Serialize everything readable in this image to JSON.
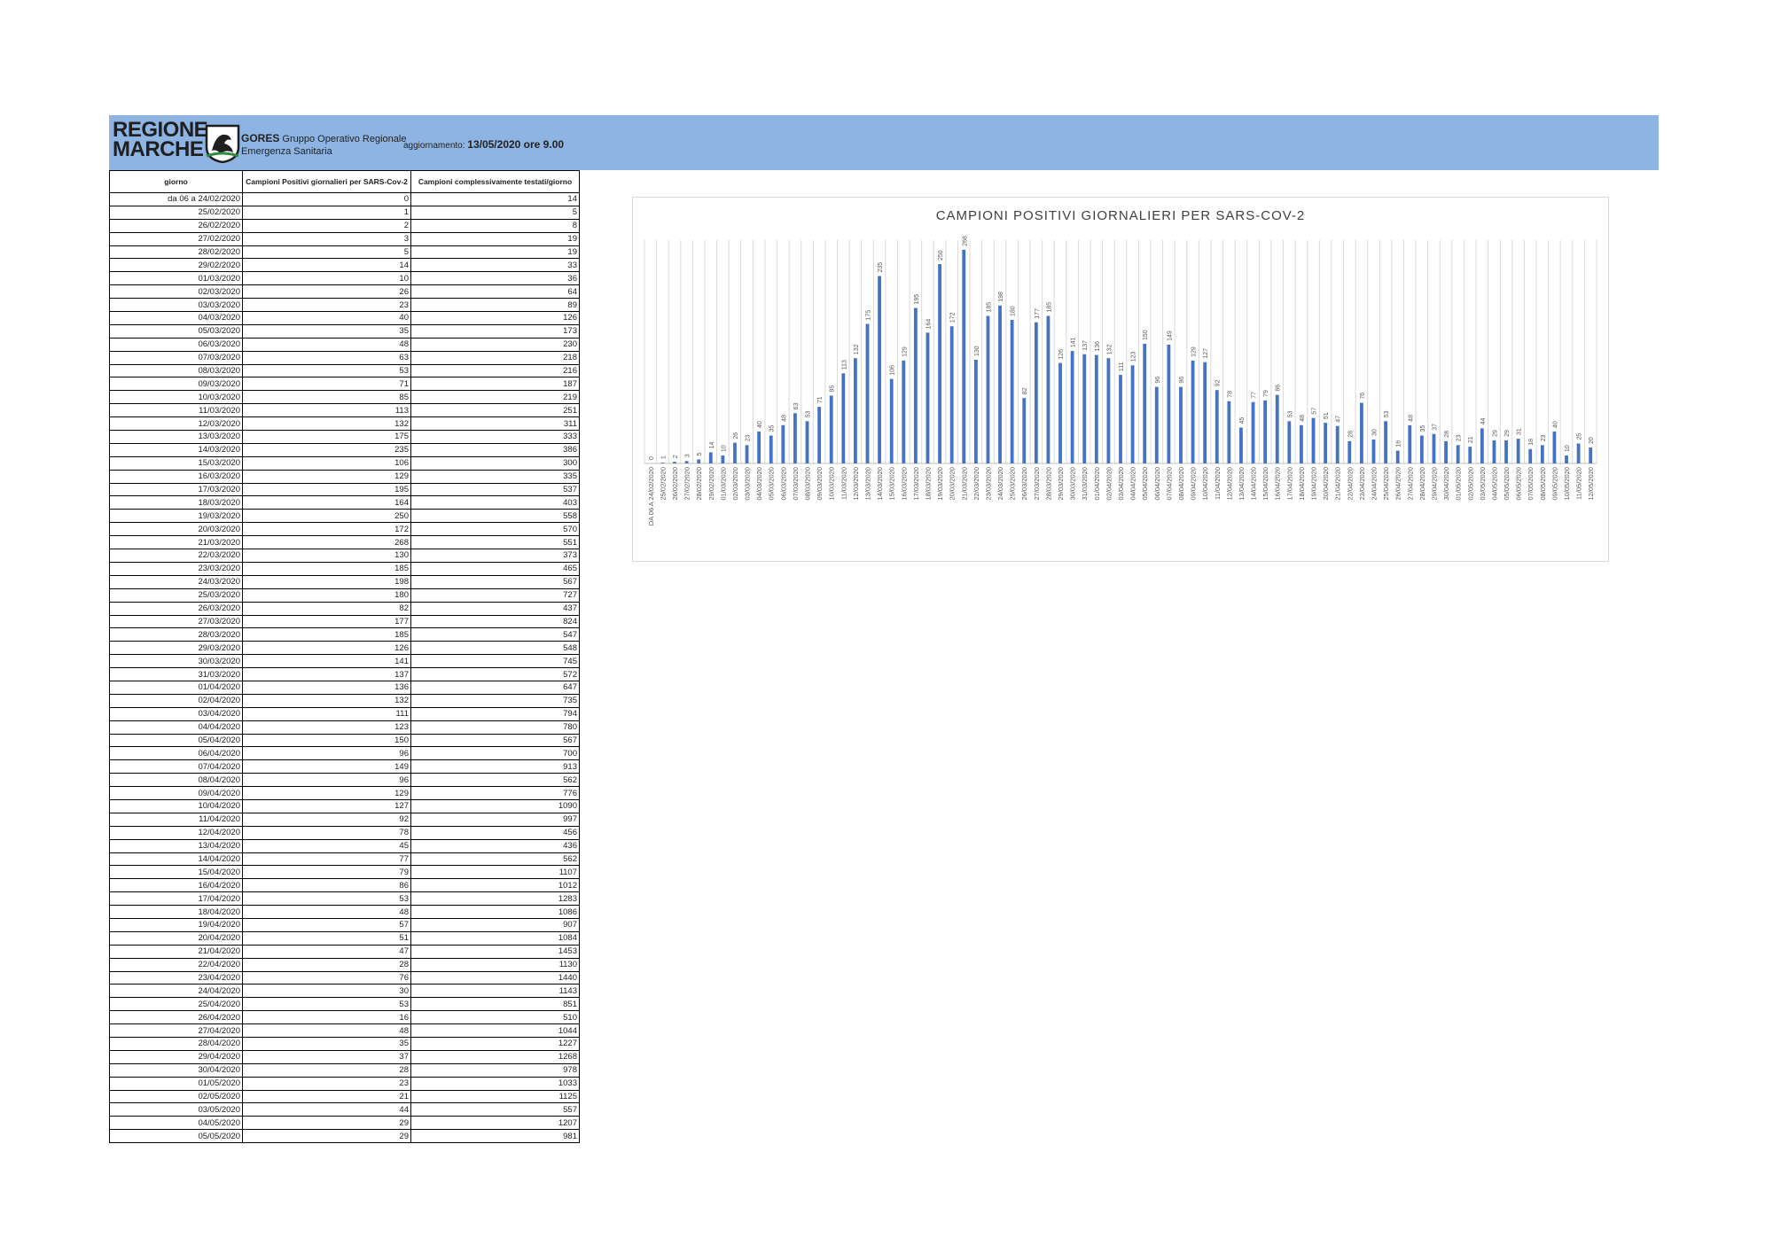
{
  "header": {
    "logo_line1": "REGIONE",
    "logo_line2": "MARCHE",
    "gores_bold": "GORES",
    "gores_line1": "Gruppo Operativo Regionale",
    "gores_line2": "Emergenza Sanitaria",
    "update_label": "aggiornamento:",
    "update_value": "13/05/2020 ore 9.00",
    "band_color": "#8eb4e3"
  },
  "table": {
    "headers": [
      "giorno",
      "Campioni Positivi giornalieri per SARS-Cov-2",
      "Campioni complessivamente testati/giorno"
    ],
    "rows": [
      [
        "da 06 a 24/02/2020",
        "0",
        "14"
      ],
      [
        "25/02/2020",
        "1",
        "5"
      ],
      [
        "26/02/2020",
        "2",
        "8"
      ],
      [
        "27/02/2020",
        "3",
        "19"
      ],
      [
        "28/02/2020",
        "5",
        "19"
      ],
      [
        "29/02/2020",
        "14",
        "33"
      ],
      [
        "01/03/2020",
        "10",
        "36"
      ],
      [
        "02/03/2020",
        "26",
        "64"
      ],
      [
        "03/03/2020",
        "23",
        "89"
      ],
      [
        "04/03/2020",
        "40",
        "126"
      ],
      [
        "05/03/2020",
        "35",
        "173"
      ],
      [
        "06/03/2020",
        "48",
        "230"
      ],
      [
        "07/03/2020",
        "63",
        "218"
      ],
      [
        "08/03/2020",
        "53",
        "216"
      ],
      [
        "09/03/2020",
        "71",
        "187"
      ],
      [
        "10/03/2020",
        "85",
        "219"
      ],
      [
        "11/03/2020",
        "113",
        "251"
      ],
      [
        "12/03/2020",
        "132",
        "311"
      ],
      [
        "13/03/2020",
        "175",
        "333"
      ],
      [
        "14/03/2020",
        "235",
        "386"
      ],
      [
        "15/03/2020",
        "106",
        "300"
      ],
      [
        "16/03/2020",
        "129",
        "335"
      ],
      [
        "17/03/2020",
        "195",
        "537"
      ],
      [
        "18/03/2020",
        "164",
        "403"
      ],
      [
        "19/03/2020",
        "250",
        "558"
      ],
      [
        "20/03/2020",
        "172",
        "570"
      ],
      [
        "21/03/2020",
        "268",
        "551"
      ],
      [
        "22/03/2020",
        "130",
        "373"
      ],
      [
        "23/03/2020",
        "185",
        "465"
      ],
      [
        "24/03/2020",
        "198",
        "567"
      ],
      [
        "25/03/2020",
        "180",
        "727"
      ],
      [
        "26/03/2020",
        "82",
        "437"
      ],
      [
        "27/03/2020",
        "177",
        "824"
      ],
      [
        "28/03/2020",
        "185",
        "547"
      ],
      [
        "29/03/2020",
        "126",
        "548"
      ],
      [
        "30/03/2020",
        "141",
        "745"
      ],
      [
        "31/03/2020",
        "137",
        "572"
      ],
      [
        "01/04/2020",
        "136",
        "647"
      ],
      [
        "02/04/2020",
        "132",
        "735"
      ],
      [
        "03/04/2020",
        "111",
        "794"
      ],
      [
        "04/04/2020",
        "123",
        "780"
      ],
      [
        "05/04/2020",
        "150",
        "567"
      ],
      [
        "06/04/2020",
        "96",
        "700"
      ],
      [
        "07/04/2020",
        "149",
        "913"
      ],
      [
        "08/04/2020",
        "96",
        "562"
      ],
      [
        "09/04/2020",
        "129",
        "776"
      ],
      [
        "10/04/2020",
        "127",
        "1090"
      ],
      [
        "11/04/2020",
        "92",
        "997"
      ],
      [
        "12/04/2020",
        "78",
        "456"
      ],
      [
        "13/04/2020",
        "45",
        "436"
      ],
      [
        "14/04/2020",
        "77",
        "562"
      ],
      [
        "15/04/2020",
        "79",
        "1107"
      ],
      [
        "16/04/2020",
        "86",
        "1012"
      ],
      [
        "17/04/2020",
        "53",
        "1283"
      ],
      [
        "18/04/2020",
        "48",
        "1086"
      ],
      [
        "19/04/2020",
        "57",
        "907"
      ],
      [
        "20/04/2020",
        "51",
        "1084"
      ],
      [
        "21/04/2020",
        "47",
        "1453"
      ],
      [
        "22/04/2020",
        "28",
        "1130"
      ],
      [
        "23/04/2020",
        "76",
        "1440"
      ],
      [
        "24/04/2020",
        "30",
        "1143"
      ],
      [
        "25/04/2020",
        "53",
        "851"
      ],
      [
        "26/04/2020",
        "16",
        "510"
      ],
      [
        "27/04/2020",
        "48",
        "1044"
      ],
      [
        "28/04/2020",
        "35",
        "1227"
      ],
      [
        "29/04/2020",
        "37",
        "1268"
      ],
      [
        "30/04/2020",
        "28",
        "978"
      ],
      [
        "01/05/2020",
        "23",
        "1033"
      ],
      [
        "02/05/2020",
        "21",
        "1125"
      ],
      [
        "03/05/2020",
        "44",
        "557"
      ],
      [
        "04/05/2020",
        "29",
        "1207"
      ],
      [
        "05/05/2020",
        "29",
        "981"
      ]
    ]
  },
  "chart_data": {
    "type": "bar",
    "title": "CAMPIONI POSITIVI GIORNALIERI PER SARS-COV-2",
    "bar_color": "#4472c4",
    "grid": "vertical",
    "legend": "none",
    "ylim": [
      0,
      280
    ],
    "categories": [
      "DA 06 A 24/02/2020",
      "25/02/2020",
      "26/02/2020",
      "27/02/2020",
      "28/02/2020",
      "29/02/2020",
      "01/03/2020",
      "02/03/2020",
      "03/03/2020",
      "04/03/2020",
      "05/03/2020",
      "06/03/2020",
      "07/03/2020",
      "08/03/2020",
      "09/03/2020",
      "10/03/2020",
      "11/03/2020",
      "12/03/2020",
      "13/03/2020",
      "14/03/2020",
      "15/03/2020",
      "16/03/2020",
      "17/03/2020",
      "18/03/2020",
      "19/03/2020",
      "20/03/2020",
      "21/03/2020",
      "22/03/2020",
      "23/03/2020",
      "24/03/2020",
      "25/03/2020",
      "26/03/2020",
      "27/03/2020",
      "28/03/2020",
      "29/03/2020",
      "30/03/2020",
      "31/03/2020",
      "01/04/2020",
      "02/04/2020",
      "03/04/2020",
      "04/04/2020",
      "05/04/2020",
      "06/04/2020",
      "07/04/2020",
      "08/04/2020",
      "09/04/2020",
      "10/04/2020",
      "11/04/2020",
      "12/04/2020",
      "13/04/2020",
      "14/04/2020",
      "15/04/2020",
      "16/04/2020",
      "17/04/2020",
      "18/04/2020",
      "19/04/2020",
      "20/04/2020",
      "21/04/2020",
      "22/04/2020",
      "23/04/2020",
      "24/04/2020",
      "25/04/2020",
      "26/04/2020",
      "27/04/2020",
      "28/04/2020",
      "29/04/2020",
      "30/04/2020",
      "01/05/2020",
      "02/05/2020",
      "03/05/2020",
      "04/05/2020",
      "05/05/2020",
      "06/05/2020",
      "07/05/2020",
      "08/05/2020",
      "09/05/2020",
      "10/05/2020",
      "11/05/2020",
      "12/05/2020"
    ],
    "values": [
      0,
      1,
      2,
      3,
      5,
      14,
      10,
      26,
      23,
      40,
      35,
      48,
      63,
      53,
      71,
      85,
      113,
      132,
      175,
      235,
      106,
      129,
      195,
      164,
      250,
      172,
      268,
      130,
      185,
      198,
      180,
      82,
      177,
      185,
      126,
      141,
      137,
      136,
      132,
      111,
      123,
      150,
      96,
      149,
      96,
      129,
      127,
      92,
      78,
      45,
      77,
      79,
      86,
      53,
      48,
      57,
      51,
      47,
      28,
      76,
      30,
      53,
      16,
      48,
      35,
      37,
      28,
      23,
      21,
      44,
      29,
      29,
      31,
      18,
      23,
      40,
      10,
      25,
      20
    ]
  }
}
